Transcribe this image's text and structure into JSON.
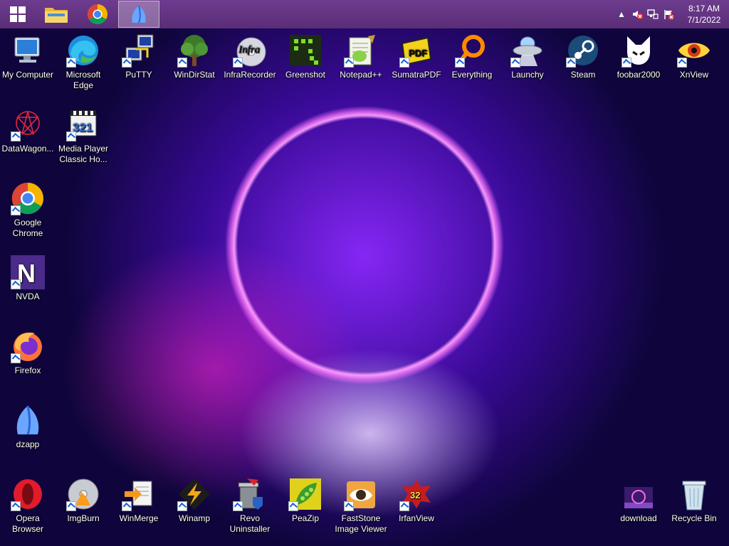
{
  "taskbar": {
    "apps": [
      "File Explorer",
      "Google Chrome",
      "dzapp"
    ],
    "clock_time": "8:17 AM",
    "clock_date": "7/1/2022"
  },
  "desktop": {
    "icons": [
      {
        "label": "My Computer"
      },
      {
        "label": "Microsoft Edge"
      },
      {
        "label": "PuTTY"
      },
      {
        "label": "WinDirStat"
      },
      {
        "label": "InfraRecorder"
      },
      {
        "label": "Greenshot"
      },
      {
        "label": "Notepad++"
      },
      {
        "label": "SumatraPDF"
      },
      {
        "label": "Everything"
      },
      {
        "label": "Launchy"
      },
      {
        "label": "Steam"
      },
      {
        "label": "foobar2000"
      },
      {
        "label": "XnView"
      },
      {
        "label": "DataWagon..."
      },
      {
        "label": "Media Player Classic Ho..."
      },
      {
        "label": "Google Chrome"
      },
      {
        "label": "NVDA"
      },
      {
        "label": "Firefox"
      },
      {
        "label": "dzapp"
      },
      {
        "label": "Opera Browser"
      },
      {
        "label": "ImgBurn"
      },
      {
        "label": "WinMerge"
      },
      {
        "label": "Winamp"
      },
      {
        "label": "Revo Uninstaller"
      },
      {
        "label": "PeaZip"
      },
      {
        "label": "FastStone Image Viewer"
      },
      {
        "label": "IrfanView"
      },
      {
        "label": "download"
      },
      {
        "label": "Recycle Bin"
      }
    ]
  },
  "icon_text": {
    "infrarecorder": "Infra",
    "sumatra": "PDF",
    "mpc": "321",
    "nvda": "N",
    "irfanview": "32"
  }
}
